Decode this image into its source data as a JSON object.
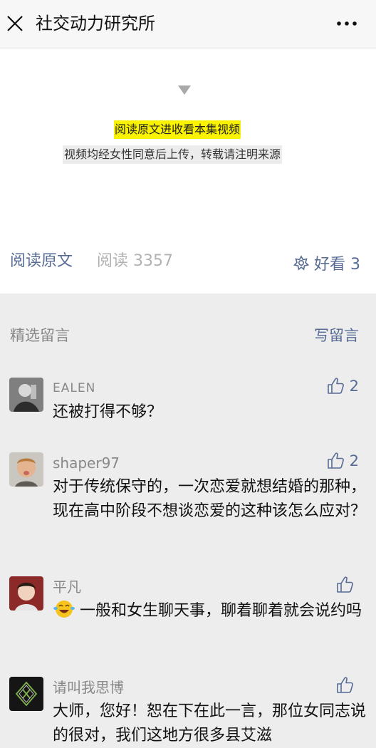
{
  "header": {
    "title": "社交动力研究所"
  },
  "article": {
    "highlight_text": "阅读原文进收看本集视频",
    "note_text": "视频均经女性同意后上传，转载请注明来源",
    "read_original": "阅读原文",
    "read_count": "阅读 3357",
    "watch_label": "好看 3"
  },
  "comments_section": {
    "label": "精选留言",
    "write_label": "写留言",
    "items": [
      {
        "name": "EALEN",
        "likes": "2",
        "text": "还被打得不够？"
      },
      {
        "name": "shaper97",
        "likes": "2",
        "text": "对于传统保守的，一次恋爱就想结婚的那种，现在高中阶段不想谈恋爱的这种该怎么应对？"
      },
      {
        "name": "平凡",
        "likes": "",
        "text": "一般和女生聊天事，聊着聊着就会说约吗"
      },
      {
        "name": "请叫我思博",
        "likes": "",
        "text": "大师，您好！恕在下在此一言，那位女同志说的很对，我们这地方很多县艾滋"
      }
    ]
  },
  "colors": {
    "link": "#576b95",
    "highlight": "#f9f200",
    "background": "#ededed"
  }
}
